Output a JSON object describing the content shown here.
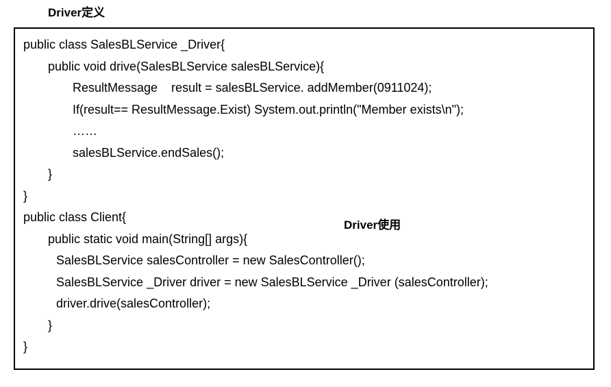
{
  "labels": {
    "driver_definition": "Driver定义",
    "driver_usage": "Driver使用"
  },
  "code": {
    "line1": "public class SalesBLService _Driver{",
    "line2": "public void drive(SalesBLService salesBLService){",
    "line3": "ResultMessage    result = salesBLService. addMember(0911024);",
    "line4": "If(result== ResultMessage.Exist) System.out.println(\"Member exists\\n\");",
    "line5": "……",
    "line6": "salesBLService.endSales();",
    "line7": "}",
    "line8": "}",
    "line9": "public class Client{",
    "line10": "public static void main(String[] args){",
    "line11": "SalesBLService salesController = new SalesController();",
    "line12": "SalesBLService _Driver driver = new SalesBLService _Driver (salesController);",
    "line13": "driver.drive(salesController);",
    "line14": "}",
    "line15": "}"
  }
}
